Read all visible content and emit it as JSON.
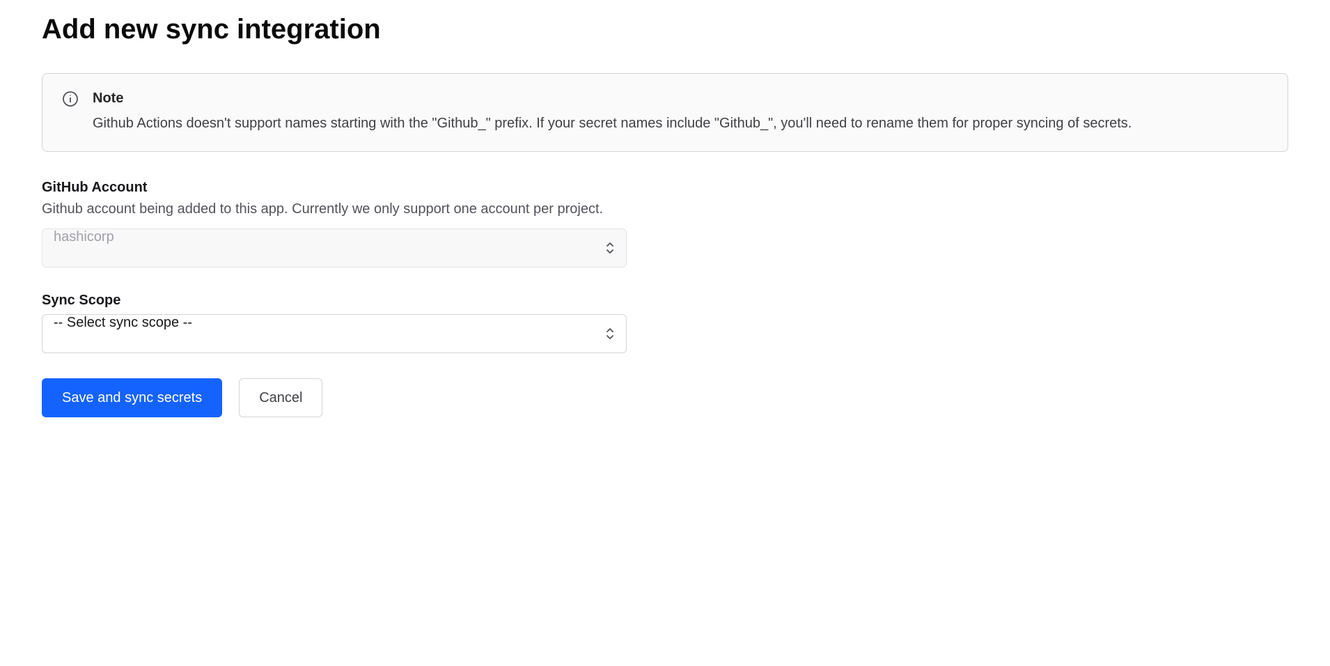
{
  "page": {
    "title": "Add new sync integration"
  },
  "note": {
    "title": "Note",
    "text": "Github Actions doesn't support names starting with the \"Github_\" prefix. If your secret names include \"Github_\", you'll need to rename them for proper syncing of secrets."
  },
  "fields": {
    "github_account": {
      "label": "GitHub Account",
      "description": "Github account being added to this app. Currently we only support one account per project.",
      "value": "hashicorp"
    },
    "sync_scope": {
      "label": "Sync Scope",
      "value": "-- Select sync scope --"
    }
  },
  "buttons": {
    "save": "Save and sync secrets",
    "cancel": "Cancel"
  }
}
